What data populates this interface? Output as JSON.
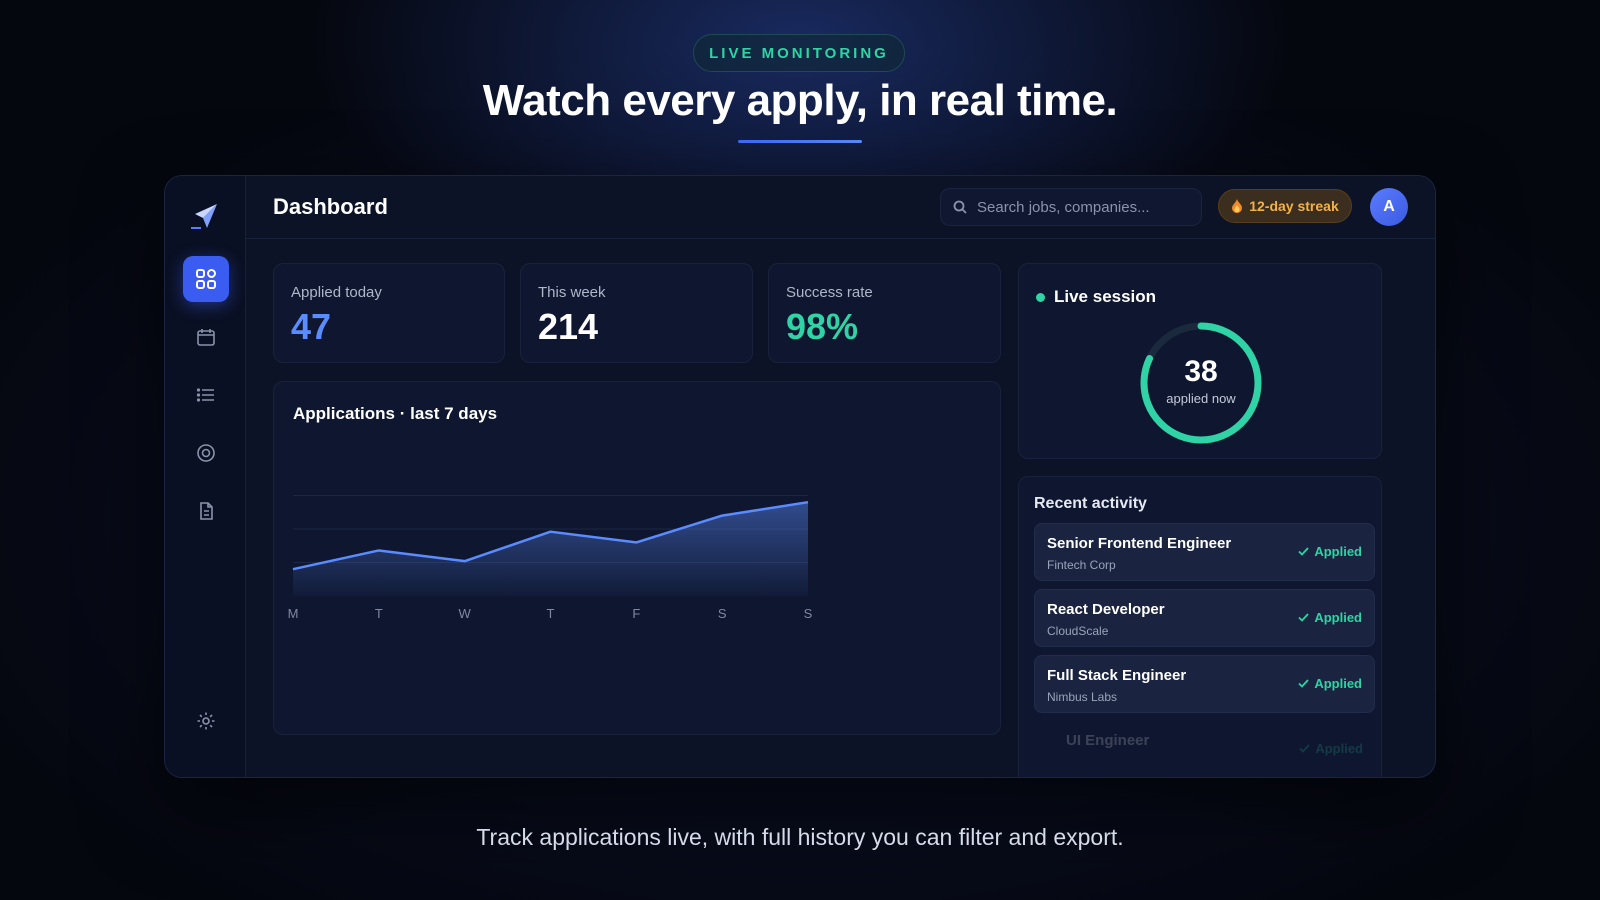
{
  "hero": {
    "badge": "LIVE MONITORING",
    "title": "Watch every apply, in real time.",
    "subtitle": "Track applications live, with full history you can filter and export."
  },
  "sidebar": {
    "items": [
      {
        "icon": "grid-icon",
        "active": true
      },
      {
        "icon": "calendar-icon",
        "active": false
      },
      {
        "icon": "list-icon",
        "active": false
      },
      {
        "icon": "target-icon",
        "active": false
      },
      {
        "icon": "document-icon",
        "active": false
      }
    ],
    "bottom_icon": "settings-icon"
  },
  "header": {
    "title": "Dashboard",
    "search_placeholder": "Search jobs, companies...",
    "streak": "12-day streak",
    "avatar_initial": "A"
  },
  "stats": [
    {
      "label": "Applied today",
      "value": "47",
      "color": "#5b8cff"
    },
    {
      "label": "This week",
      "value": "214",
      "color": "#ffffff"
    },
    {
      "label": "Success rate",
      "value": "98%",
      "color": "#2fd3a5"
    }
  ],
  "chart_data": {
    "type": "area",
    "title": "Applications · last 7 days",
    "categories": [
      "M",
      "T",
      "W",
      "T",
      "F",
      "S",
      "S"
    ],
    "values": [
      10,
      17,
      13,
      24,
      20,
      30,
      35
    ],
    "ylim": [
      0,
      50
    ],
    "grid": true,
    "color": "#5b8cff"
  },
  "live_session": {
    "title": "Live session",
    "count": "38",
    "count_label": "applied now",
    "progress": 0.82,
    "color": "#2fd3a5"
  },
  "activity": {
    "title": "Recent activity",
    "items": [
      {
        "role": "Senior Frontend Engineer",
        "company": "Fintech Corp",
        "status": "Applied"
      },
      {
        "role": "React Developer",
        "company": "CloudScale",
        "status": "Applied"
      },
      {
        "role": "Full Stack Engineer",
        "company": "Nimbus Labs",
        "status": "Applied"
      },
      {
        "role": "UI Engineer",
        "company": "",
        "status": "Applied"
      }
    ]
  }
}
